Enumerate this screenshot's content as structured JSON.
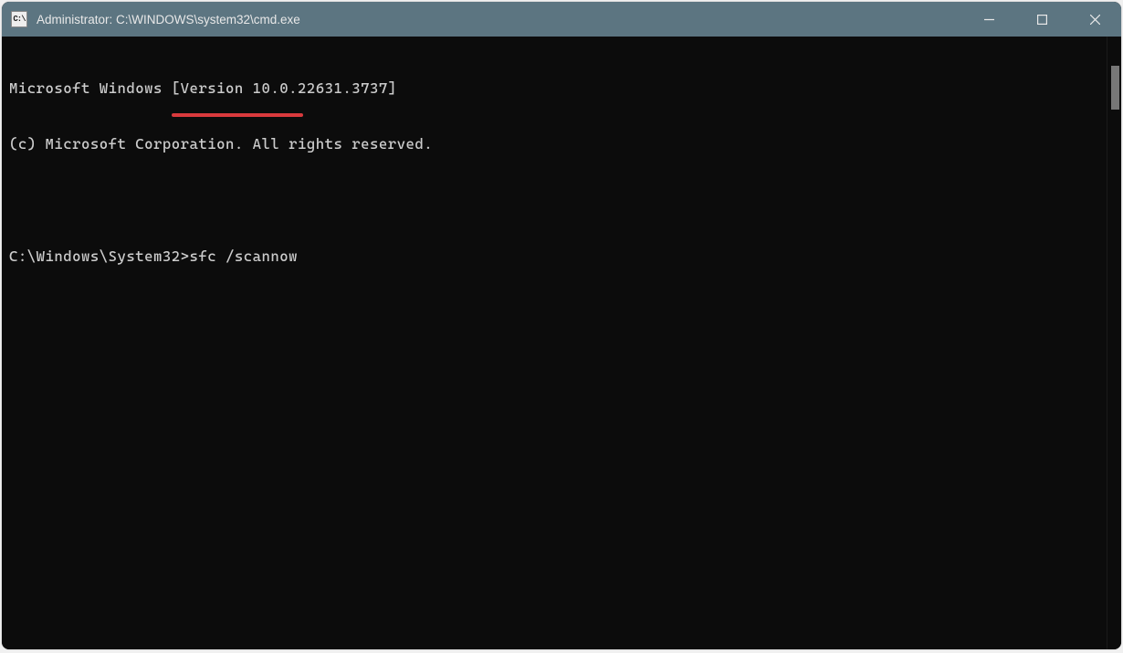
{
  "titlebar": {
    "icon_text": "C:\\",
    "title": "Administrator: C:\\WINDOWS\\system32\\cmd.exe"
  },
  "terminal": {
    "line1": "Microsoft Windows [Version 10.0.22631.3737]",
    "line2": "(c) Microsoft Corporation. All rights reserved.",
    "prompt": "C:\\Windows\\System32>",
    "command": "sfc /scannow"
  },
  "annotation": {
    "underline_color": "#d93a3d"
  }
}
